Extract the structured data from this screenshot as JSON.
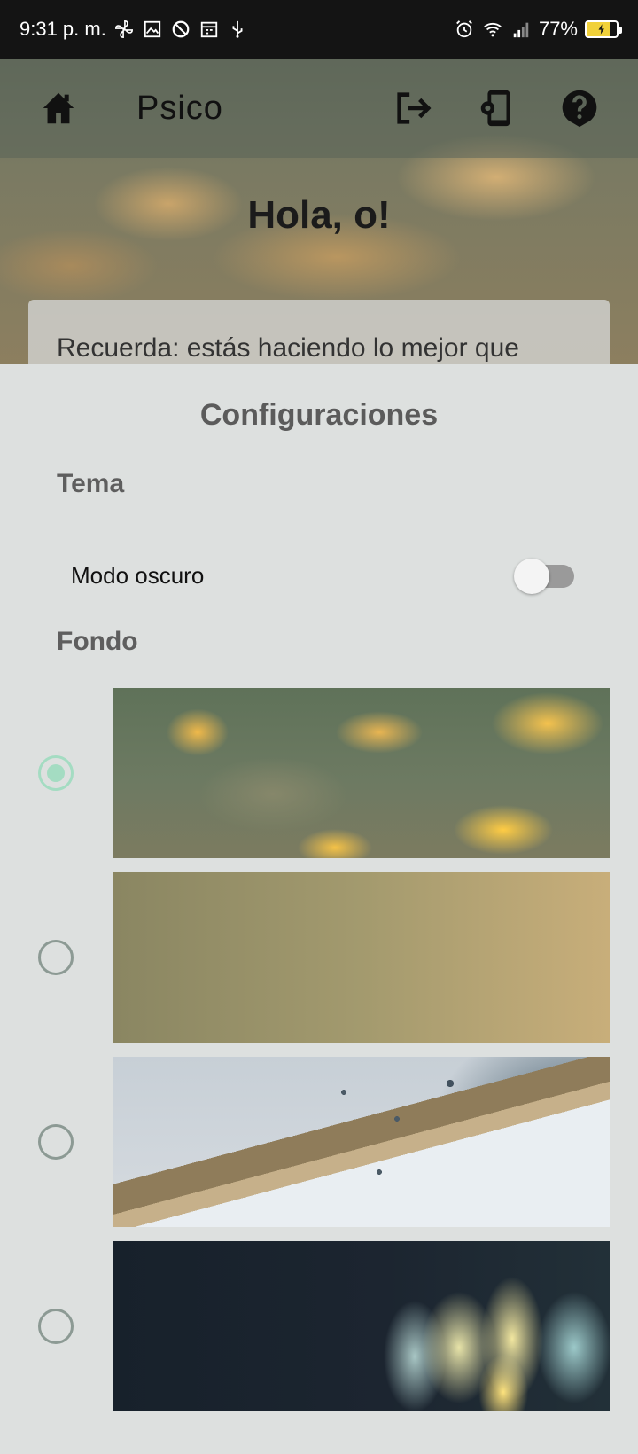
{
  "status_bar": {
    "time": "9:31 p. m.",
    "battery_percent": "77%",
    "left_icons": [
      "fan-icon",
      "image-icon",
      "at-icon",
      "calendar-icon",
      "usb-icon"
    ],
    "right_icons": [
      "alarm-icon",
      "wifi-icon",
      "signal-icon",
      "battery-charging-icon"
    ]
  },
  "toolbar": {
    "title": "Psico",
    "icons": [
      "home-icon",
      "logout-icon",
      "phone-settings-icon",
      "help-icon"
    ]
  },
  "main": {
    "greeting": "Hola, o!",
    "reminder": "Recuerda: estás haciendo lo mejor que"
  },
  "settings_sheet": {
    "title": "Configuraciones",
    "theme_section": "Tema",
    "dark_mode_label": "Modo oscuro",
    "dark_mode_enabled": false,
    "background_section": "Fondo",
    "backgrounds": [
      {
        "name": "clouds",
        "selected": true
      },
      {
        "name": "gradient",
        "selected": false
      },
      {
        "name": "rainy-beach",
        "selected": false
      },
      {
        "name": "lotus",
        "selected": false
      }
    ]
  },
  "colors": {
    "sheet_background": "#dde0df",
    "radio_selected": "#a4dcc2",
    "radio_unselected": "#8c9a94",
    "status_bar": "#141414"
  }
}
